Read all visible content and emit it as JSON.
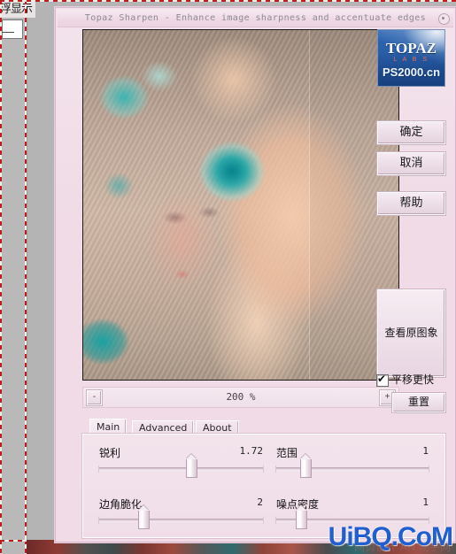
{
  "host": {
    "menu_text": "浮显示",
    "name": "photo-editor-background"
  },
  "dialog": {
    "title": "Topaz Sharpen - Enhance image sharpness and accentuate edges",
    "close_icon": "close-circle-icon"
  },
  "preview": {
    "description": "portrait of woman with blonde curly hair and teal roses",
    "split_divider": true
  },
  "zoom": {
    "minus_label": "-",
    "plus_label": "+",
    "level": "200 %"
  },
  "logo": {
    "brand": "TOPAZ",
    "sub": "L A B S",
    "watermark": "PS2000.cn"
  },
  "side_buttons": {
    "ok": "确定",
    "cancel": "取消",
    "help": "帮助",
    "view_original": "查看原图象",
    "pan_faster": "平移更快",
    "pan_faster_checked": true,
    "reset": "重置"
  },
  "tabs": [
    {
      "label": "Main",
      "active": true
    },
    {
      "label": "Advanced",
      "active": false
    },
    {
      "label": "About",
      "active": false
    }
  ],
  "controls": [
    {
      "name": "锐利",
      "value": "1.72",
      "percent": 56
    },
    {
      "name": "范围",
      "value": "1",
      "percent": 19
    },
    {
      "name": "边角脆化",
      "value": "2",
      "percent": 27
    },
    {
      "name": "噪点密度",
      "value": "1",
      "percent": 16
    }
  ],
  "watermarks": {
    "site": "UiBQ.CoM",
    "cn_text": "网页设计 AN 动手网"
  },
  "colors": {
    "dialog_bg": "#f0dbe6",
    "title_text": "#8d8a95",
    "accent_blue": "#1f5fd0",
    "logo_blue": "#2a5ea8",
    "logo_orange": "#e8714a"
  }
}
